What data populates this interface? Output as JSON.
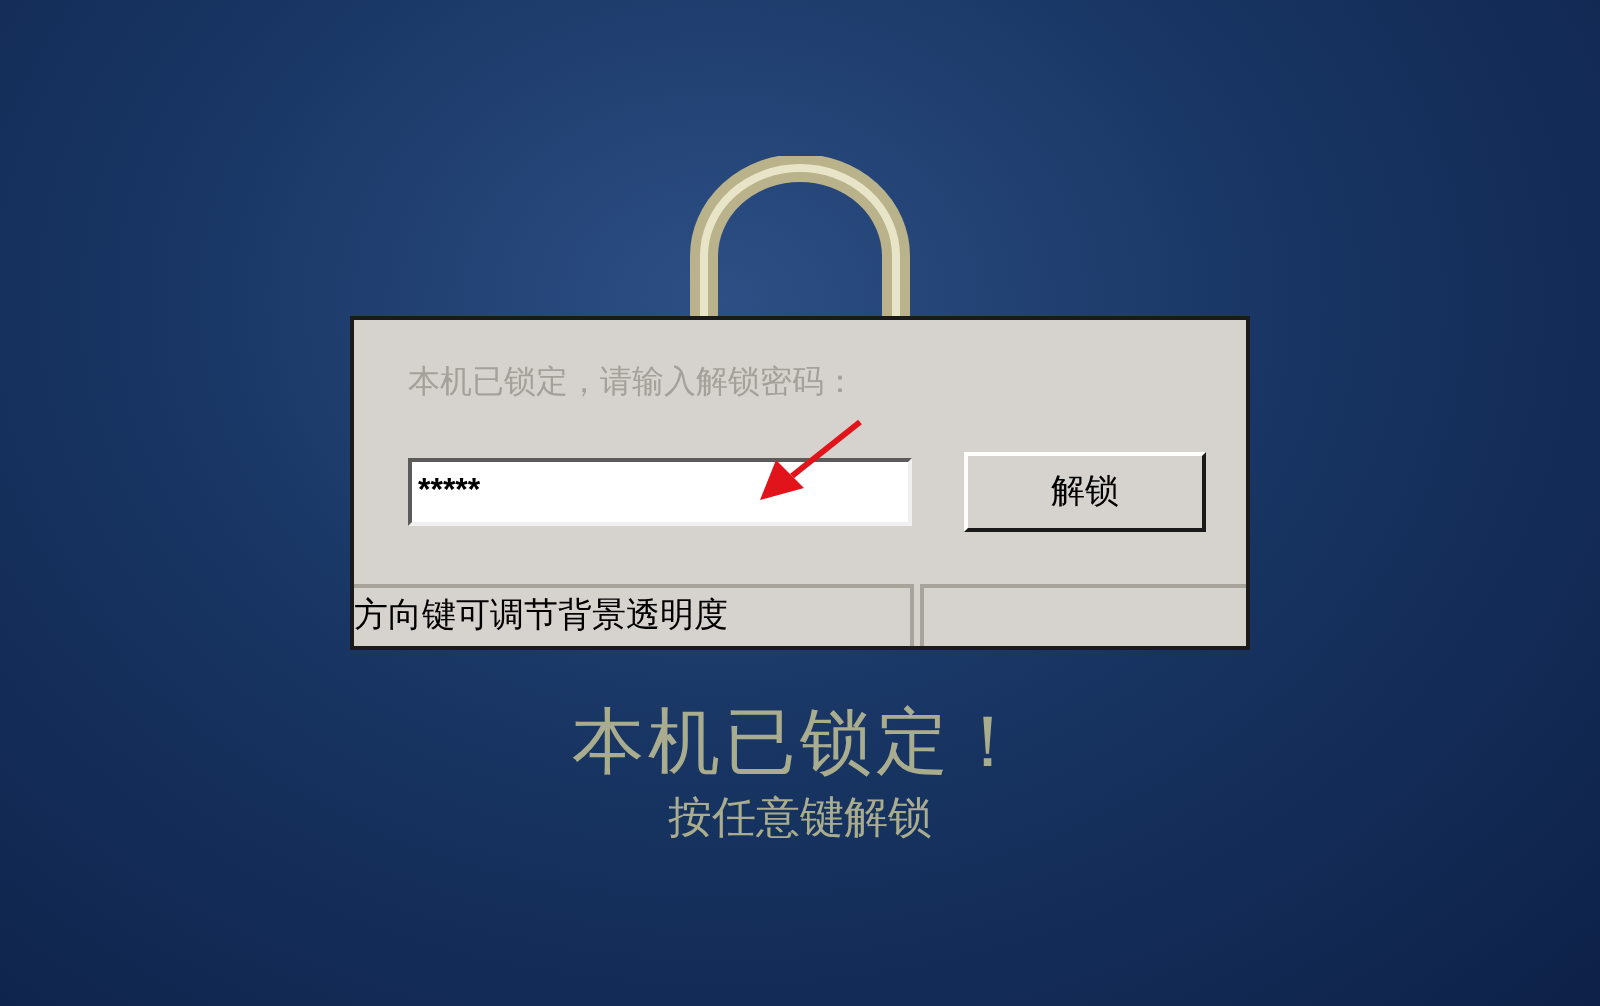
{
  "dialog": {
    "prompt": "本机已锁定，请输入解锁密码：",
    "password": {
      "value": "*****"
    },
    "unlock_button": "解锁",
    "status_bar": [
      "方向键可调节背景透明度"
    ]
  },
  "lock_message": {
    "title": "本机已锁定！",
    "hint": "按任意键解锁"
  }
}
